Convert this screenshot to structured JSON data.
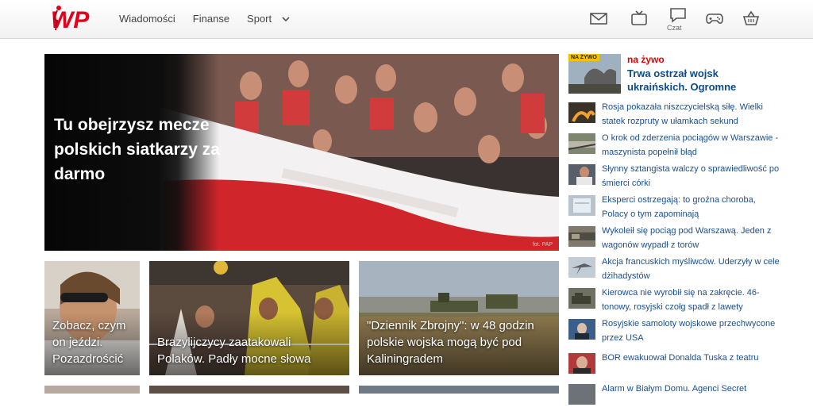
{
  "header": {
    "logo_alt": "WP",
    "nav": [
      "Wiadomości",
      "Finanse",
      "Sport"
    ],
    "icons": [
      "mail-icon",
      "tv-icon",
      "chat-icon",
      "gamepad-icon",
      "basket-icon"
    ],
    "czat_label": "Czat"
  },
  "hero": {
    "title": "Tu obejrzysz mecze polskich siatkarzy za darmo",
    "photo_credit": "fot. PAP"
  },
  "cards": [
    {
      "caption": "Zobacz, czym on jeździ. Pozazdrościć"
    },
    {
      "caption": "Brazylijczycy zaatakowali Polaków. Padły mocne słowa"
    },
    {
      "caption": "\"Dziennik Zbrojny\": w 48 godzin polskie wojska mogą być pod Kaliningradem"
    }
  ],
  "sidebar": {
    "live": {
      "badge": "NA ŻYWO",
      "label": "na żywo",
      "headline": "Trwa ostrzał wojsk ukraińskich. Ogromne"
    },
    "items": [
      {
        "text": "Rosja pokazała niszczycielską siłę. Wielki statek rozpruty w ułamkach sekund"
      },
      {
        "text": "O krok od zderzenia pociągów w Warszawie - maszynista popełnił błąd"
      },
      {
        "text": "Słynny sztangista walczy o sprawiedliwość po śmierci córki"
      },
      {
        "text": "Eksperci ostrzegają: to groźna choroba, Polacy o tym zapominają"
      },
      {
        "text": "Wykoleił się pociąg pod Warszawą. Jeden z wagonów wypadł z torów"
      },
      {
        "text": "Akcja francuskich myśliwców. Uderzyły w cele dżihadystów"
      },
      {
        "text": "Kierowca nie wyrobił się na zakręcie. 46-tonowy, rosyjski czołg spadł z lawety"
      },
      {
        "text": "Rosyjskie samoloty wojskowe przechwycone przez USA"
      },
      {
        "text": "BOR ewakuował Donalda Tuska z teatru"
      },
      {
        "text": "Alarm w Białym Domu. Agenci Secret"
      }
    ]
  },
  "colors": {
    "brand_red": "#e2001a",
    "link_blue": "#1b4f8e",
    "live_red": "#e00000"
  }
}
